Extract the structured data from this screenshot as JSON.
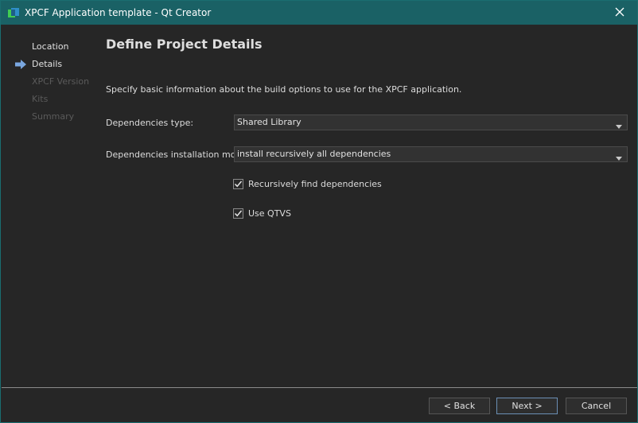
{
  "window": {
    "title": "XPCF Application template - Qt Creator",
    "accent_color": "#1a6165",
    "close_icon": "close-icon",
    "app_icon": "qt-creator-icon"
  },
  "sidebar": {
    "current_marker_icon": "arrow-right-icon",
    "steps": [
      {
        "label": "Location",
        "state": "done"
      },
      {
        "label": "Details",
        "state": "current"
      },
      {
        "label": "XPCF Version",
        "state": "future"
      },
      {
        "label": "Kits",
        "state": "future"
      },
      {
        "label": "Summary",
        "state": "future"
      }
    ]
  },
  "page": {
    "title": "Define Project Details",
    "description": "Specify basic information about the build options to use for the XPCF application."
  },
  "form": {
    "dependencies_type": {
      "label": "Dependencies type:",
      "value": "Shared Library"
    },
    "installation_mode": {
      "label": "Dependencies installation mode:",
      "value": "install recursively all dependencies"
    },
    "recursive_find": {
      "label": "Recursively find dependencies",
      "checked": true
    },
    "use_qtvs": {
      "label": "Use QTVS",
      "checked": true
    }
  },
  "buttons": {
    "back": "< Back",
    "next": "Next >",
    "cancel": "Cancel"
  }
}
